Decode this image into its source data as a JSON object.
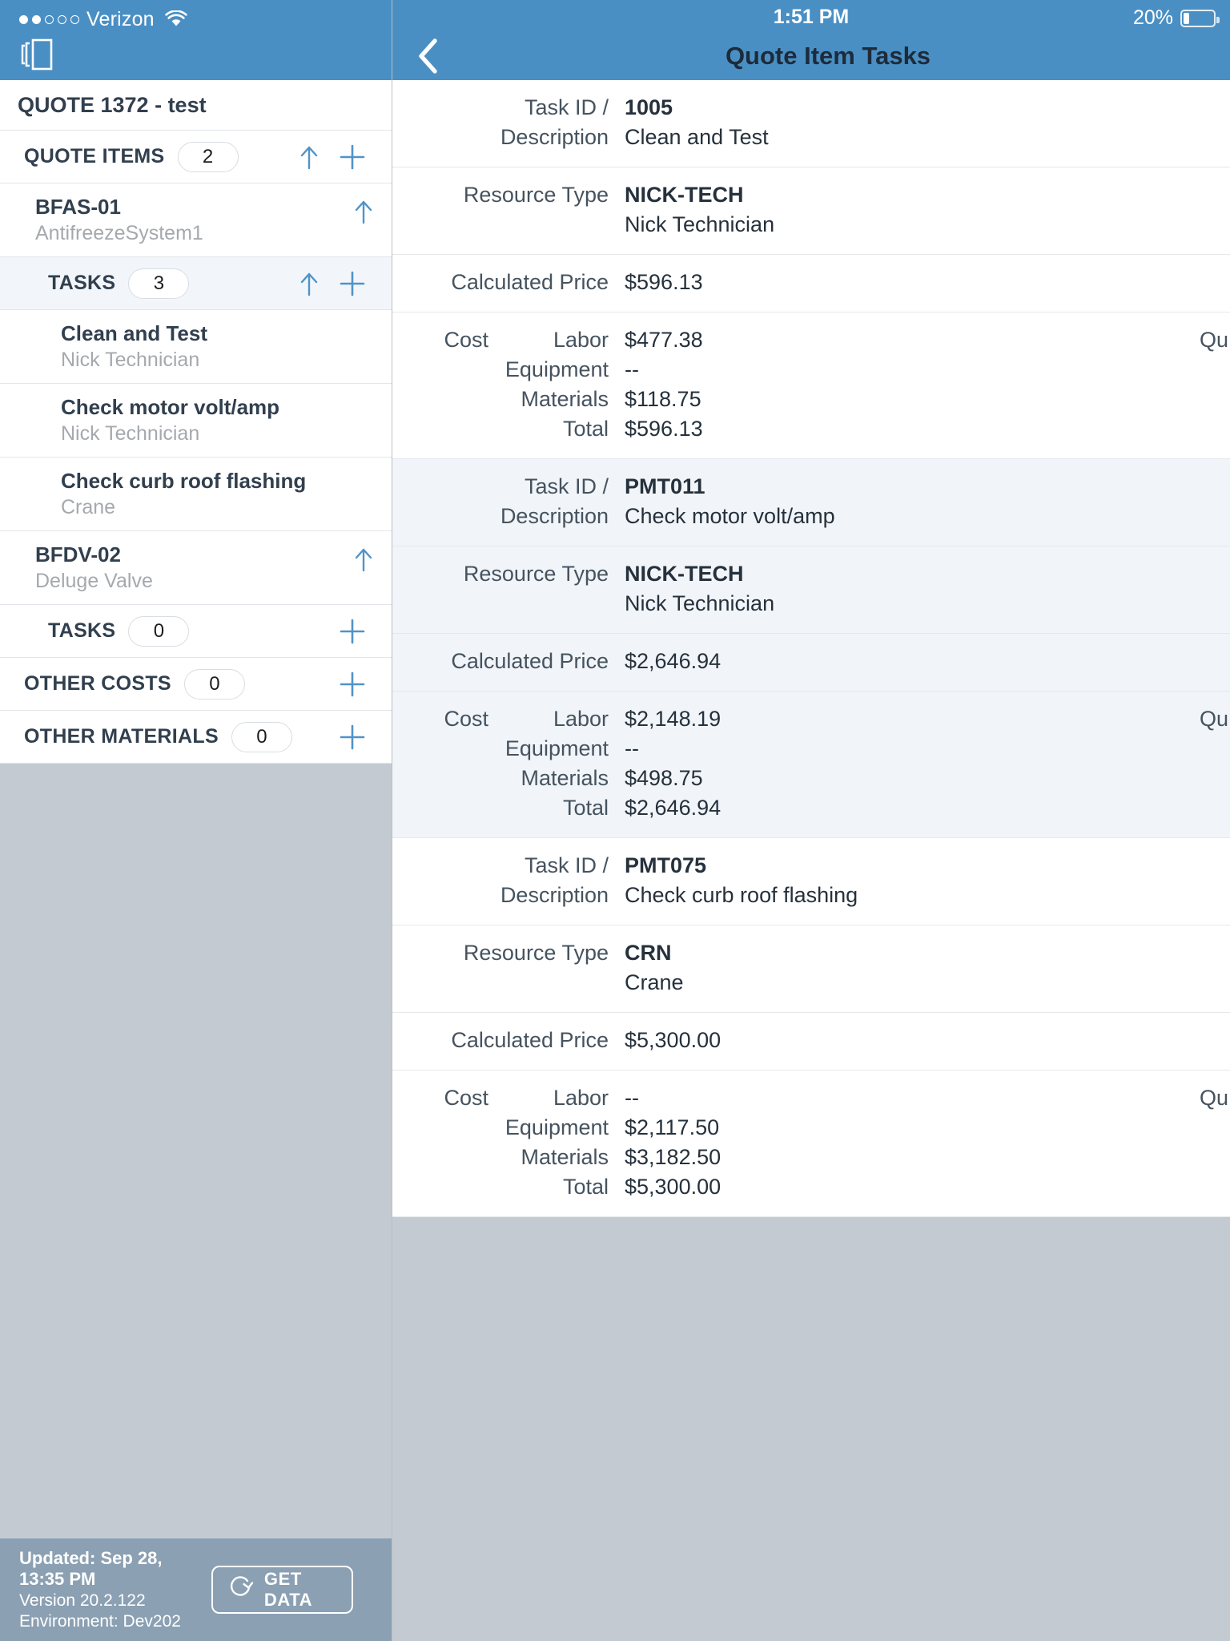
{
  "status_bar": {
    "carrier": "Verizon",
    "signal_dots_filled": 2,
    "signal_dots_total": 5,
    "wifi_icon": "wifi-icon",
    "time": "1:51 PM",
    "battery_percent": "20%",
    "battery_level": 20
  },
  "left_pane": {
    "menu_icon": "book-panel-icon",
    "quote_title": "QUOTE 1372 - test",
    "sections": [
      {
        "id": "quote-items",
        "label": "QUOTE ITEMS",
        "count": "2",
        "has_up_arrow": true,
        "has_add": true,
        "indent": false,
        "highlight": false
      }
    ],
    "items": [
      {
        "type": "quote-item",
        "title": "BFAS-01",
        "subtitle": "AntifreezeSystem1",
        "has_up_arrow": true
      },
      {
        "type": "section",
        "label": "TASKS",
        "count": "3",
        "has_up_arrow": true,
        "has_add": true,
        "indent": true,
        "highlight": true
      },
      {
        "type": "task",
        "title": "Clean and Test",
        "subtitle": "Nick Technician"
      },
      {
        "type": "task",
        "title": "Check motor volt/amp",
        "subtitle": "Nick Technician"
      },
      {
        "type": "task",
        "title": "Check curb roof flashing",
        "subtitle": "Crane"
      },
      {
        "type": "quote-item",
        "title": "BFDV-02",
        "subtitle": "Deluge Valve",
        "has_up_arrow": true
      },
      {
        "type": "section",
        "label": "TASKS",
        "count": "0",
        "has_up_arrow": false,
        "has_add": true,
        "indent": true,
        "highlight": false
      },
      {
        "type": "section",
        "label": "OTHER COSTS",
        "count": "0",
        "has_up_arrow": false,
        "has_add": true,
        "indent": false,
        "highlight": false
      },
      {
        "type": "section",
        "label": "OTHER MATERIALS",
        "count": "0",
        "has_up_arrow": false,
        "has_add": true,
        "indent": false,
        "highlight": false
      }
    ],
    "footer": {
      "updated": "Updated: Sep 28, 13:35 PM",
      "version": "Version 20.2.122",
      "environment": "Environment: Dev202",
      "get_data_label": "GET DATA",
      "refresh_icon": "refresh-icon"
    }
  },
  "right_pane": {
    "back_icon": "back-chevron-icon",
    "title": "Quote Item Tasks",
    "labels": {
      "task_id": "Task ID /",
      "description": "Description",
      "resource_type": "Resource Type",
      "calculated_price": "Calculated Price",
      "cost": "Cost",
      "labor": "Labor",
      "equipment": "Equipment",
      "materials": "Materials",
      "total": "Total",
      "trailing_truncated": "Qu"
    },
    "tasks": [
      {
        "task_id": "1005",
        "description": "Clean and Test",
        "resource_type_code": "NICK-TECH",
        "resource_type_name": "Nick Technician",
        "calculated_price": "$596.13",
        "cost_labor": "$477.38",
        "cost_equipment": "--",
        "cost_materials": "$118.75",
        "cost_total": "$596.13",
        "alt_background": false
      },
      {
        "task_id": "PMT011",
        "description": "Check motor volt/amp",
        "resource_type_code": "NICK-TECH",
        "resource_type_name": "Nick Technician",
        "calculated_price": "$2,646.94",
        "cost_labor": "$2,148.19",
        "cost_equipment": "--",
        "cost_materials": "$498.75",
        "cost_total": "$2,646.94",
        "alt_background": true
      },
      {
        "task_id": "PMT075",
        "description": "Check curb roof flashing",
        "resource_type_code": "CRN",
        "resource_type_name": "Crane",
        "calculated_price": "$5,300.00",
        "cost_labor": "--",
        "cost_equipment": "$2,117.50",
        "cost_materials": "$3,182.50",
        "cost_total": "$5,300.00",
        "alt_background": false
      }
    ]
  },
  "colors": {
    "header_blue": "#4a8fc4",
    "accent_blue": "#4a8fc4",
    "text_dark": "#313f4e",
    "text_muted": "#a5a9ae",
    "filler_gray": "#c3cad2",
    "footer_gray": "#8ba0b2",
    "row_highlight": "#f1f5f9"
  }
}
